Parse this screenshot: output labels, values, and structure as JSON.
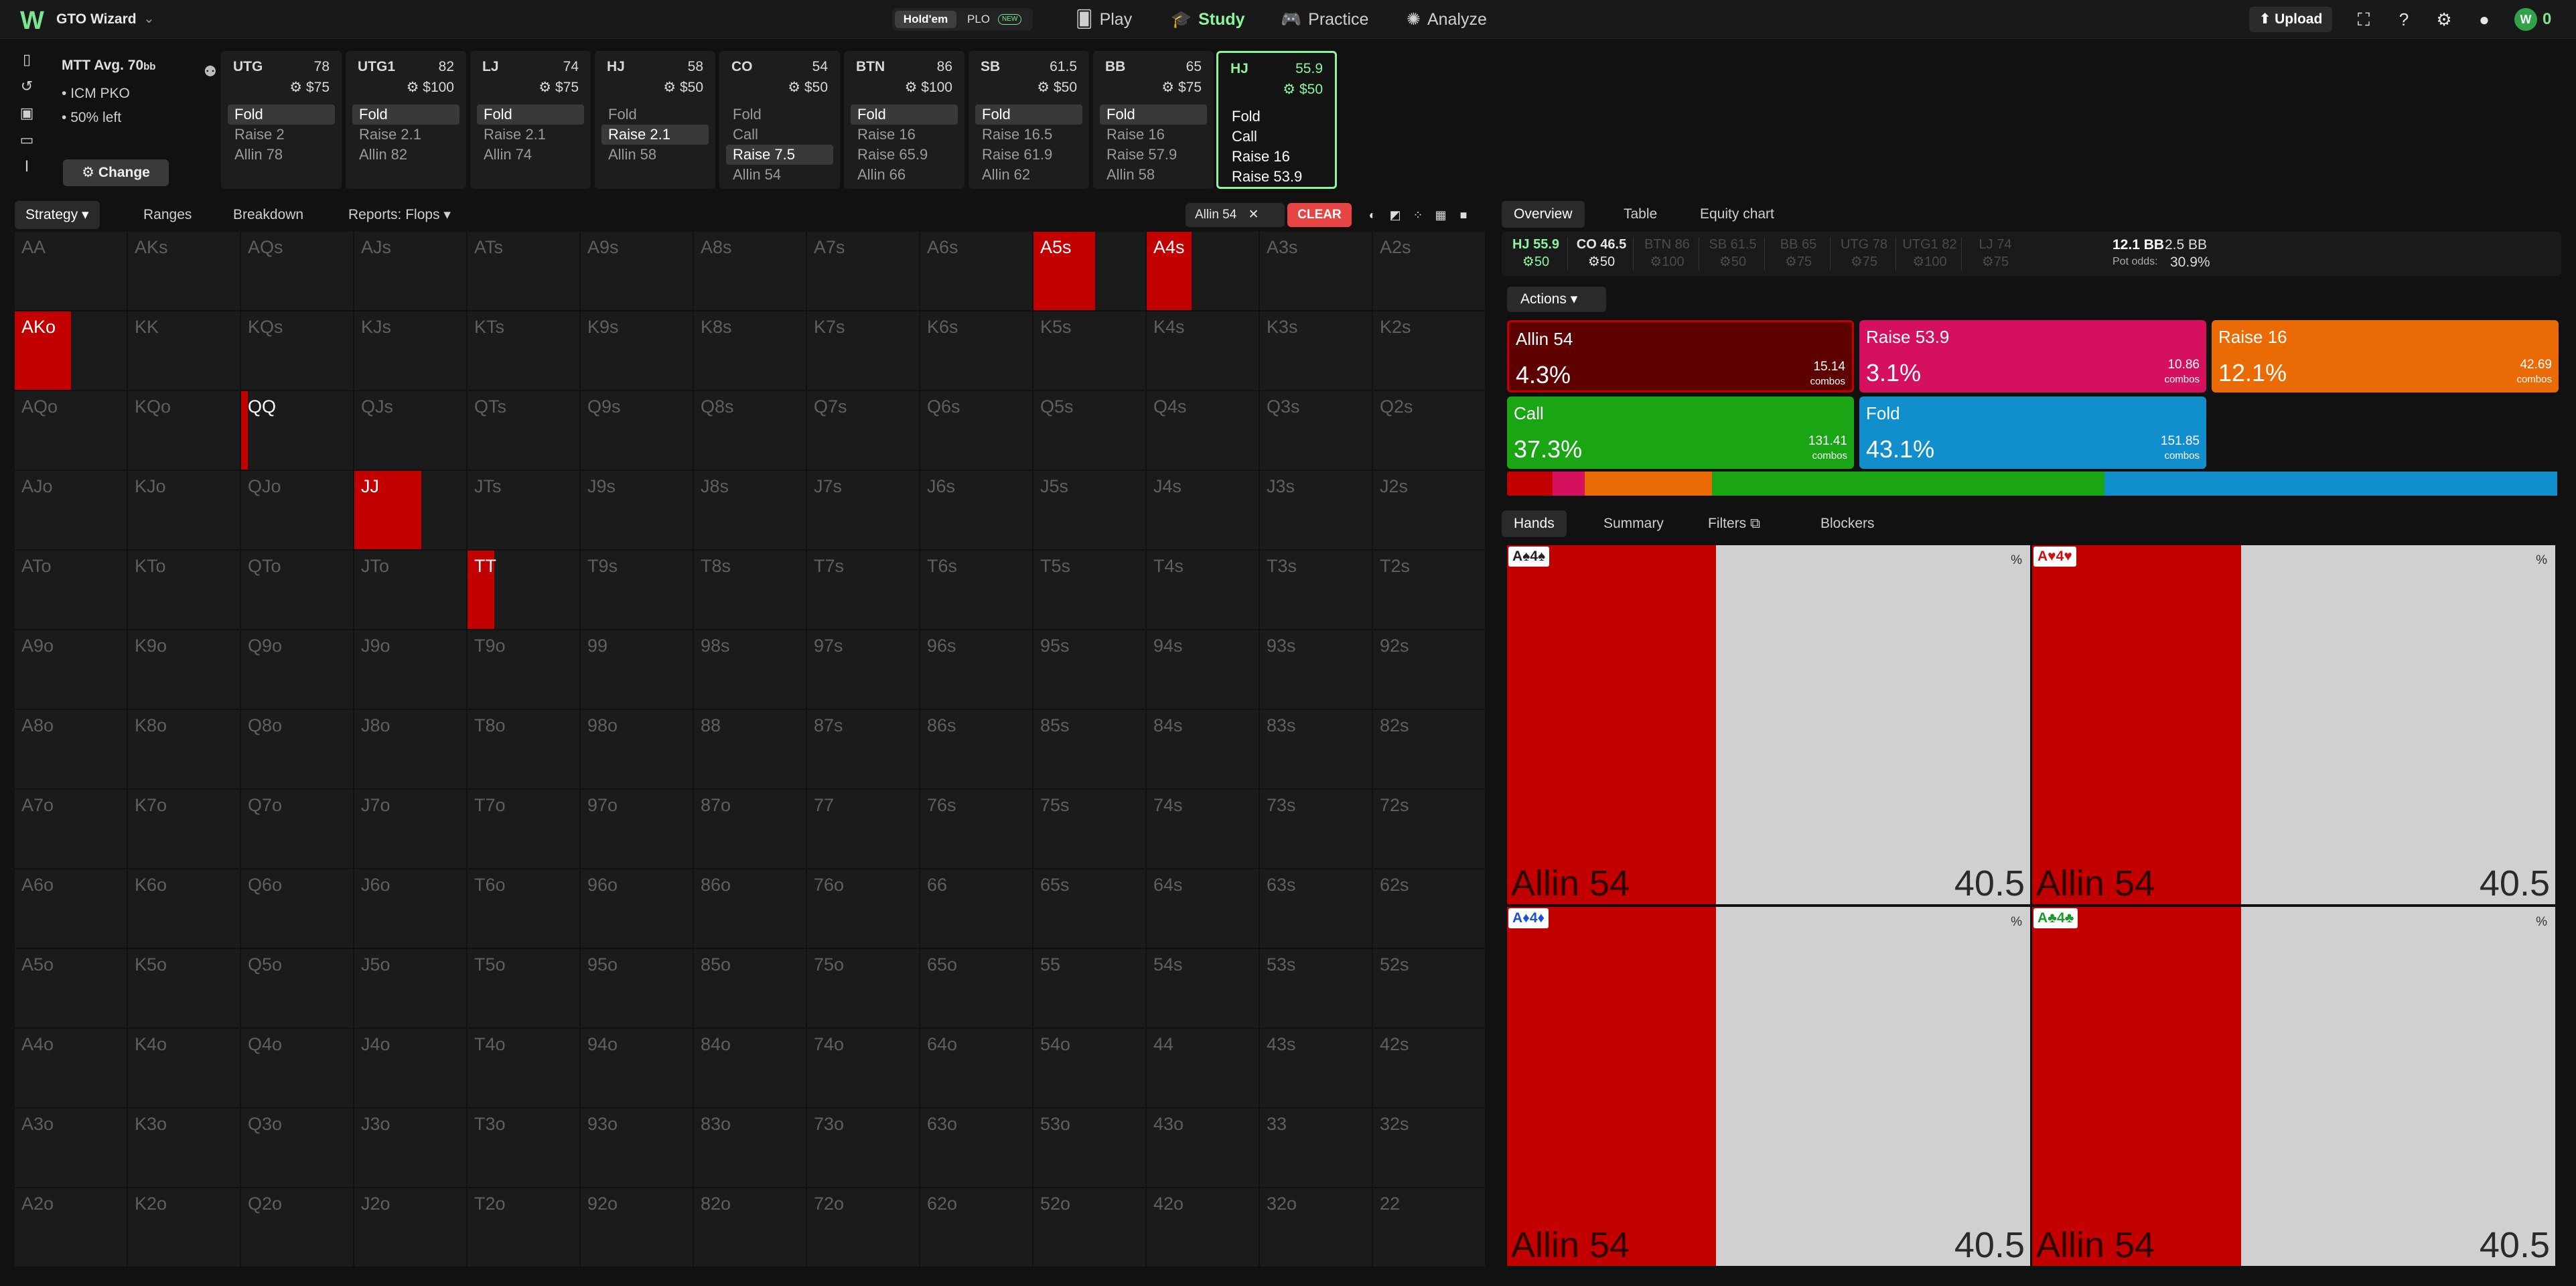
{
  "nav": {
    "logo": "W",
    "brand": "GTO Wizard",
    "mode_holdem": "Hold'em",
    "mode_plo": "PLO",
    "mode_plo_badge": "NEW",
    "items": [
      {
        "label": "Play",
        "icon": "cards-icon"
      },
      {
        "label": "Study",
        "icon": "graduation-cap-icon",
        "active": true
      },
      {
        "label": "Practice",
        "icon": "gamepad-icon"
      },
      {
        "label": "Analyze",
        "icon": "bulb-icon"
      }
    ],
    "upload": "Upload",
    "credits": "0"
  },
  "game": {
    "title": "MTT",
    "avg": "Avg. 70",
    "avg_unit": "bb",
    "bullets": [
      "ICM PKO",
      "50% left"
    ],
    "change": "Change"
  },
  "positions": [
    {
      "pos": "UTG",
      "stack": "78",
      "bounty": "$75",
      "actions": [
        {
          "t": "Fold",
          "on": true
        },
        {
          "t": "Raise 2"
        },
        {
          "t": "Allin 78"
        }
      ]
    },
    {
      "pos": "UTG1",
      "stack": "82",
      "bounty": "$100",
      "actions": [
        {
          "t": "Fold",
          "on": true
        },
        {
          "t": "Raise 2.1"
        },
        {
          "t": "Allin 82"
        }
      ]
    },
    {
      "pos": "LJ",
      "stack": "74",
      "bounty": "$75",
      "actions": [
        {
          "t": "Fold",
          "on": true
        },
        {
          "t": "Raise 2.1"
        },
        {
          "t": "Allin 74"
        }
      ]
    },
    {
      "pos": "HJ",
      "stack": "58",
      "bounty": "$50",
      "actions": [
        {
          "t": "Fold"
        },
        {
          "t": "Raise 2.1",
          "on": true
        },
        {
          "t": "Allin 58"
        }
      ]
    },
    {
      "pos": "CO",
      "stack": "54",
      "bounty": "$50",
      "actions": [
        {
          "t": "Fold"
        },
        {
          "t": "Call"
        },
        {
          "t": "Raise 7.5",
          "on": true
        },
        {
          "t": "Allin 54"
        }
      ]
    },
    {
      "pos": "BTN",
      "stack": "86",
      "bounty": "$100",
      "actions": [
        {
          "t": "Fold",
          "on": true
        },
        {
          "t": "Raise 16"
        },
        {
          "t": "Raise 65.9"
        },
        {
          "t": "Allin 66"
        }
      ]
    },
    {
      "pos": "SB",
      "stack": "61.5",
      "bounty": "$50",
      "actions": [
        {
          "t": "Fold",
          "on": true
        },
        {
          "t": "Raise 16.5"
        },
        {
          "t": "Raise 61.9"
        },
        {
          "t": "Allin 62"
        }
      ]
    },
    {
      "pos": "BB",
      "stack": "65",
      "bounty": "$75",
      "actions": [
        {
          "t": "Fold",
          "on": true
        },
        {
          "t": "Raise 16"
        },
        {
          "t": "Raise 57.9"
        },
        {
          "t": "Allin 58"
        }
      ]
    },
    {
      "pos": "HJ",
      "stack": "55.9",
      "bounty": "$50",
      "current": true,
      "actions": [
        {
          "t": "Fold"
        },
        {
          "t": "Call"
        },
        {
          "t": "Raise 16"
        },
        {
          "t": "Raise 53.9"
        }
      ]
    }
  ],
  "toolbar": {
    "strategy": "Strategy",
    "ranges": "Ranges",
    "breakdown": "Breakdown",
    "reports": "Reports: Flops",
    "filter_chip": "Allin 54",
    "clear": "CLEAR"
  },
  "grid": {
    "ranks": [
      "A",
      "K",
      "Q",
      "J",
      "T",
      "9",
      "8",
      "7",
      "6",
      "5",
      "4",
      "3",
      "2"
    ],
    "allin_freq": {
      "A5s": 0.55,
      "A4s": 0.4,
      "AKo": 0.5,
      "QQ": 0.06,
      "JJ": 0.6,
      "TT": 0.24
    }
  },
  "right": {
    "tabs": [
      "Overview",
      "Table",
      "Equity chart"
    ],
    "positions": [
      {
        "pos": "HJ",
        "stack": "55.9",
        "bounty": "50",
        "state": "cur"
      },
      {
        "pos": "CO",
        "stack": "46.5",
        "bounty": "50",
        "state": "past"
      },
      {
        "pos": "BTN",
        "stack": "86",
        "bounty": "100",
        "state": "dim"
      },
      {
        "pos": "SB",
        "stack": "61.5",
        "bounty": "50",
        "state": "dim"
      },
      {
        "pos": "BB",
        "stack": "65",
        "bounty": "75",
        "state": "dim"
      },
      {
        "pos": "UTG",
        "stack": "78",
        "bounty": "75",
        "state": "dim"
      },
      {
        "pos": "UTG1",
        "stack": "82",
        "bounty": "100",
        "state": "dim"
      },
      {
        "pos": "LJ",
        "stack": "74",
        "bounty": "75",
        "state": "dim"
      }
    ],
    "pot": "12.1 BB",
    "pot2": "2.5 BB",
    "pot_odds_label": "Pot odds:",
    "pot_odds": "30.9%",
    "actions_label": "Actions",
    "actions": [
      {
        "name": "Allin 54",
        "pct": "4.3%",
        "combos": "15.14",
        "color": "#5e0000",
        "border": "#c20000",
        "freq": 4.3
      },
      {
        "name": "Raise 53.9",
        "pct": "3.1%",
        "combos": "10.86",
        "color": "#d5105e",
        "freq": 3.1
      },
      {
        "name": "Raise 16",
        "pct": "12.1%",
        "combos": "42.69",
        "color": "#ea6a06",
        "freq": 12.1
      },
      {
        "name": "Call",
        "pct": "37.3%",
        "combos": "131.41",
        "color": "#1aa514",
        "freq": 37.3
      },
      {
        "name": "Fold",
        "pct": "43.1%",
        "combos": "151.85",
        "color": "#118fcc",
        "freq": 43.1
      }
    ],
    "dist_first_color": "#c20000",
    "combos_word": "combos",
    "hand_tabs": [
      "Hands",
      "Summary",
      "Filters",
      "Blockers"
    ],
    "hands": [
      {
        "cards": "A♠4♠",
        "color": "#222222",
        "action": "Allin 54",
        "value": "40.5",
        "freq": 0.4
      },
      {
        "cards": "A♥4♥",
        "color": "#d01010",
        "action": "Allin 54",
        "value": "40.5",
        "freq": 0.4
      },
      {
        "cards": "A♦4♦",
        "color": "#1a4fd6",
        "action": "Allin 54",
        "value": "40.5",
        "freq": 0.4
      },
      {
        "cards": "A♣4♣",
        "color": "#1a9a2a",
        "action": "Allin 54",
        "value": "40.5",
        "freq": 0.4
      }
    ],
    "pct_symbol": "%"
  }
}
